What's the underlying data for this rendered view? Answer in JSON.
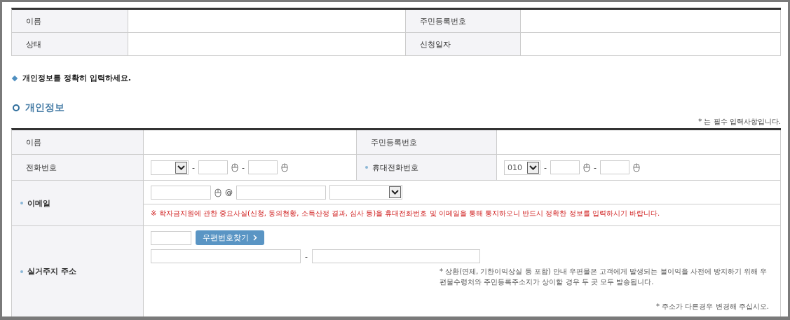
{
  "summary_table": {
    "rows": [
      {
        "cells": [
          {
            "label": "이름"
          },
          {
            "label": "주민등록번호"
          }
        ]
      },
      {
        "cells": [
          {
            "label": "상태"
          },
          {
            "label": "신청일자"
          }
        ]
      }
    ]
  },
  "notice": "개인정보를 정확히 입력하세요.",
  "section_title": "개인정보",
  "required_note": "* 는 필수 입력사항입니다.",
  "form": {
    "separator": "-",
    "rows": [
      {
        "kind": "pair",
        "cells": [
          {
            "label": "이름",
            "required": false,
            "kind": "text"
          },
          {
            "label": "주민등록번호",
            "required": false,
            "kind": "text"
          }
        ]
      },
      {
        "kind": "pair",
        "cells": [
          {
            "label": "전화번호",
            "required": false,
            "kind": "phone"
          },
          {
            "label": "휴대전화번호",
            "required": true,
            "kind": "phone",
            "prefix": "010"
          }
        ]
      },
      {
        "kind": "email",
        "label": "이메일",
        "required": true,
        "at": "@",
        "warning": "※ 학자금지원에 관한 중요사실(신청, 동의현황, 소득산정 결과, 심사 등)을 휴대전화번호 및 이메일을 통해 통지하오니 반드시 정확한 정보를 입력하시기 바랍니다."
      },
      {
        "kind": "address",
        "label": "실거주지 주소",
        "required": true,
        "button": "우편번호찾기",
        "notes": [
          "* 상환(연체, 기한이익상실 등 포함) 안내 우편물은 고객에게 발생되는 불이익을 사전에 방지하기 위해 우편물수령처와 주민등록주소지가 상이할 경우 두 곳 모두 발송됩니다.",
          "* 주소가 다른경우 변경해 주십시오."
        ]
      }
    ]
  }
}
